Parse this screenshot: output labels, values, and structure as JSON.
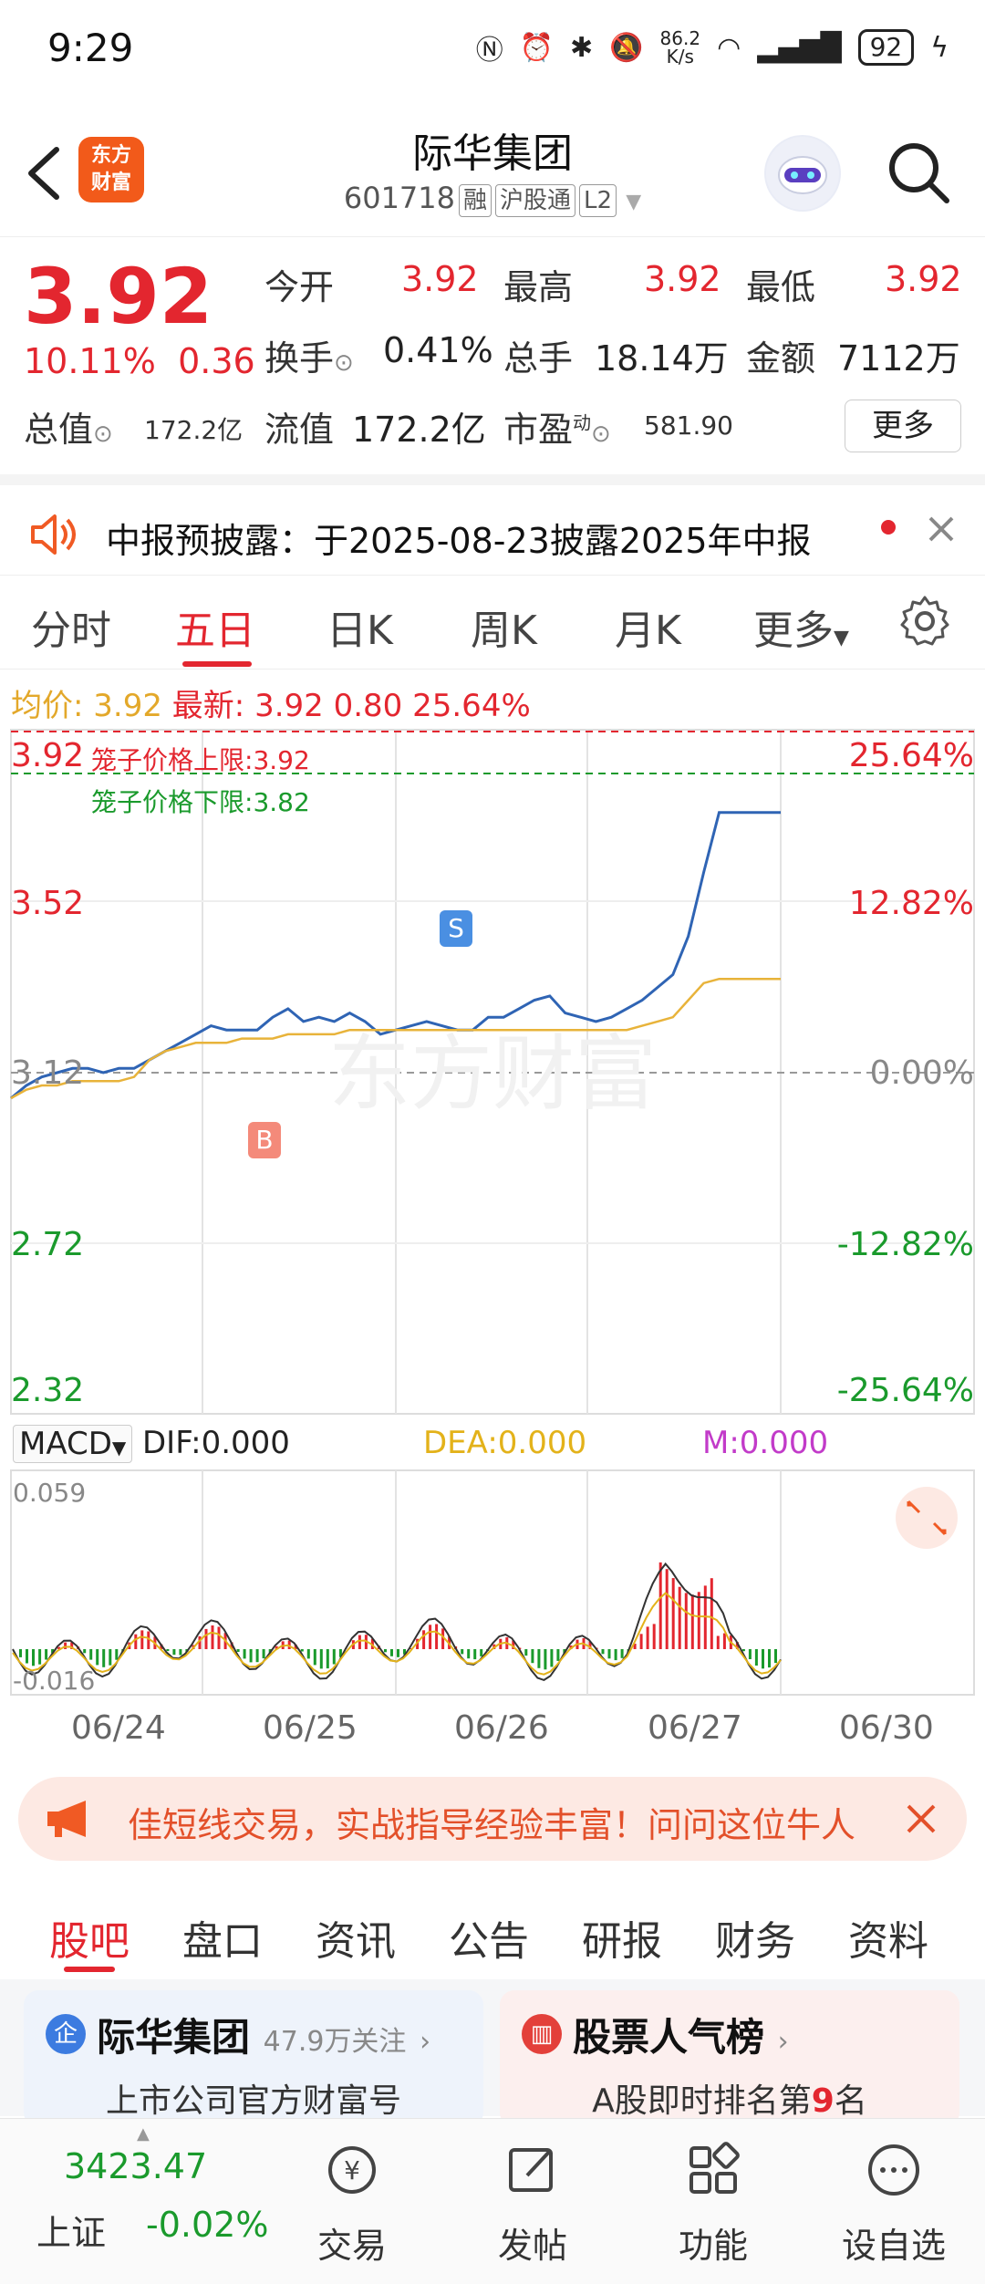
{
  "status_bar": {
    "time": "9:29",
    "net_speed": "86.2",
    "net_unit": "K/s",
    "battery": "92"
  },
  "header": {
    "logo_line1": "东方",
    "logo_line2": "财富",
    "title": "际华集团",
    "code": "601718",
    "tags": [
      "融",
      "沪股通",
      "L2"
    ]
  },
  "quote": {
    "price": "3.92",
    "change_pct": "10.11%",
    "change_amt": "0.36",
    "rows": [
      [
        {
          "label": "今开",
          "value": "3.92",
          "color": "red"
        },
        {
          "label": "最高",
          "value": "3.92",
          "color": "red"
        },
        {
          "label": "最低",
          "value": "3.92",
          "color": "red"
        }
      ],
      [
        {
          "label": "换手",
          "value": "0.41%",
          "color": "black"
        },
        {
          "label": "总手",
          "value": "18.14万",
          "color": "black"
        },
        {
          "label": "金额",
          "value": "7112万",
          "color": "black"
        }
      ]
    ],
    "total_value_label": "总值",
    "total_value": "172.2亿",
    "float_value_label": "流值",
    "float_value": "172.2亿",
    "pe_label": "市盈",
    "pe_sup": "动",
    "pe_value": "581.90",
    "more": "更多"
  },
  "notice": {
    "text": "中报预披露：于2025-08-23披露2025年中报"
  },
  "tabs": [
    "分时",
    "五日",
    "日K",
    "周K",
    "月K",
    "更多"
  ],
  "active_tab": 1,
  "info_line": {
    "avg_label": "均价:",
    "avg_value": "3.92",
    "latest_label": "最新:",
    "latest_value": "3.92",
    "change": "0.80",
    "pct": "25.64%"
  },
  "chart_data": {
    "type": "line",
    "x_labels": [
      "06/24",
      "06/25",
      "06/26",
      "06/27",
      "06/30"
    ],
    "y_ticks_left": [
      "3.92",
      "3.52",
      "3.12",
      "2.72",
      "2.32"
    ],
    "y_ticks_right": [
      "25.64%",
      "12.82%",
      "0.00%",
      "-12.82%",
      "-25.64%"
    ],
    "ylim": [
      2.32,
      3.92
    ],
    "cage_upper_label": "笼子价格上限:",
    "cage_upper_value": "3.92",
    "cage_lower_label": "笼子价格下限:",
    "cage_lower_value": "3.82",
    "buy_marker": "B",
    "sell_marker": "S",
    "watermark": "东方财富",
    "series": [
      {
        "values": [
          3.06,
          3.09,
          3.11,
          3.12,
          3.13,
          3.13,
          3.12,
          3.13,
          3.13,
          3.15,
          3.17,
          3.19,
          3.21,
          3.23,
          3.22,
          3.22,
          3.22,
          3.25,
          3.27,
          3.24,
          3.25,
          3.24,
          3.26,
          3.24,
          3.21,
          3.22,
          3.23,
          3.24,
          3.23,
          3.22,
          3.22,
          3.25,
          3.25,
          3.27,
          3.29,
          3.3,
          3.26,
          3.25,
          3.24,
          3.25,
          3.27,
          3.29,
          3.32,
          3.35,
          3.44,
          3.59,
          3.73,
          3.73,
          3.73,
          3.73,
          3.73
        ]
      },
      {
        "values": [
          3.06,
          3.08,
          3.09,
          3.09,
          3.1,
          3.1,
          3.1,
          3.1,
          3.11,
          3.15,
          3.17,
          3.18,
          3.19,
          3.19,
          3.19,
          3.2,
          3.2,
          3.2,
          3.21,
          3.21,
          3.21,
          3.21,
          3.22,
          3.22,
          3.22,
          3.22,
          3.22,
          3.22,
          3.22,
          3.22,
          3.22,
          3.22,
          3.22,
          3.22,
          3.22,
          3.22,
          3.22,
          3.22,
          3.22,
          3.22,
          3.22,
          3.23,
          3.24,
          3.25,
          3.29,
          3.33,
          3.34,
          3.34,
          3.34,
          3.34,
          3.34
        ]
      }
    ]
  },
  "macd": {
    "label": "MACD",
    "dif": "DIF:0.000",
    "dea": "DEA:0.000",
    "m": "M:0.000",
    "ymax": "0.059",
    "ymin": "-0.016"
  },
  "ad": {
    "text": "佳短线交易，实战指导经验丰富！问问这位牛人"
  },
  "subtabs": [
    "股吧",
    "盘口",
    "资讯",
    "公告",
    "研报",
    "财务",
    "资料"
  ],
  "active_subtab": 0,
  "cards": {
    "left_title": "际华集团",
    "left_follow": "47.9万关注",
    "left_sub": "上市公司官方财富号",
    "right_title": "股票人气榜",
    "right_sub_prefix": "A股即时排名第",
    "right_rank": "9",
    "right_sub_suffix": "名"
  },
  "bottom_nav": {
    "index_value": "3423.47",
    "index_name": "上证",
    "index_change": "-0.02%",
    "items": [
      "交易",
      "发帖",
      "功能",
      "设自选"
    ]
  }
}
